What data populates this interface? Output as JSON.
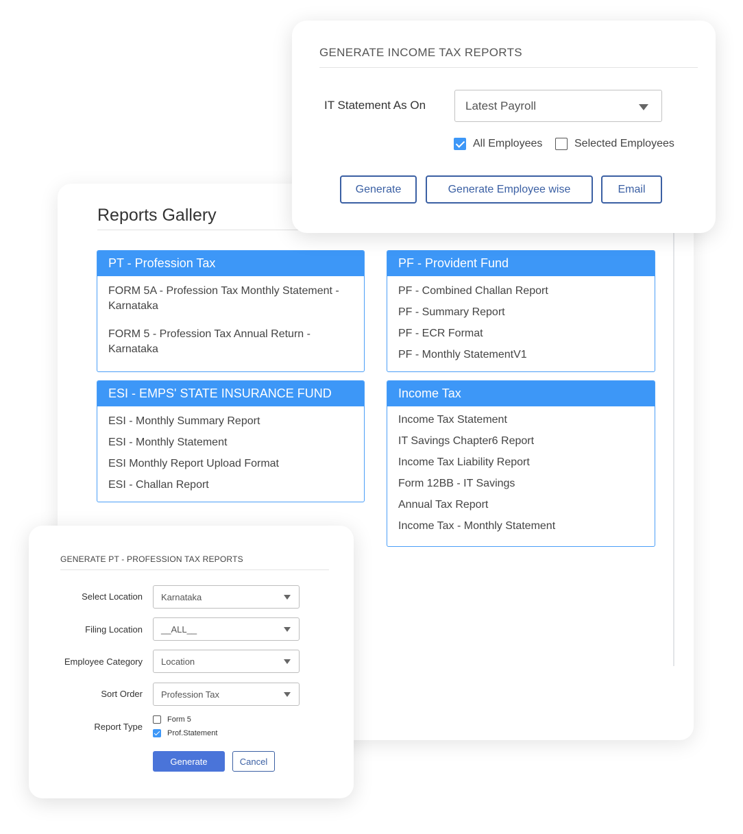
{
  "gallery": {
    "title": "Reports Gallery",
    "cards": {
      "pt": {
        "header": "PT - Profession Tax",
        "items": [
          "FORM 5A - Profession Tax Monthly Statement - Karnataka",
          "FORM 5 - Profession Tax Annual Return - Karnataka"
        ]
      },
      "pf": {
        "header": "PF - Provident Fund",
        "items": [
          "PF - Combined Challan Report",
          "PF - Summary Report",
          "PF - ECR Format",
          "PF - Monthly StatementV1"
        ]
      },
      "esi": {
        "header": "ESI - EMPS' STATE INSURANCE FUND",
        "items": [
          "ESI - Monthly Summary Report",
          "ESI - Monthly Statement",
          "ESI Monthly Report Upload Format",
          "ESI - Challan Report"
        ]
      },
      "it": {
        "header": "Income Tax",
        "items": [
          "Income Tax Statement",
          "IT Savings Chapter6 Report",
          "Income Tax Liability Report",
          "Form 12BB - IT Savings",
          "Annual Tax Report",
          "Income Tax - Monthly Statement"
        ]
      }
    }
  },
  "it_reports": {
    "title": "GENERATE INCOME TAX REPORTS",
    "statement_label": "IT Statement As On",
    "statement_value": "Latest Payroll",
    "all_employees": {
      "label": "All Employees",
      "checked": true
    },
    "selected_employees": {
      "label": "Selected Employees",
      "checked": false
    },
    "buttons": {
      "generate": "Generate",
      "generate_employee_wise": "Generate Employee wise",
      "email": "Email"
    }
  },
  "pt_reports": {
    "title": "GENERATE PT - PROFESSION TAX REPORTS",
    "fields": {
      "select_location": {
        "label": "Select Location",
        "value": "Karnataka"
      },
      "filing_location": {
        "label": "Filing Location",
        "value": "__ALL__"
      },
      "employee_category": {
        "label": "Employee Category",
        "value": "Location"
      },
      "sort_order": {
        "label": "Sort Order",
        "value": "Profession Tax"
      }
    },
    "report_type": {
      "label": "Report Type",
      "options": [
        {
          "label": "Form 5",
          "checked": false
        },
        {
          "label": "Prof.Statement",
          "checked": true
        }
      ]
    },
    "buttons": {
      "generate": "Generate",
      "cancel": "Cancel"
    }
  },
  "colors": {
    "card_header": "#3d97f7",
    "button_outline": "#3a5fa3",
    "primary_button": "#4a74d9"
  }
}
